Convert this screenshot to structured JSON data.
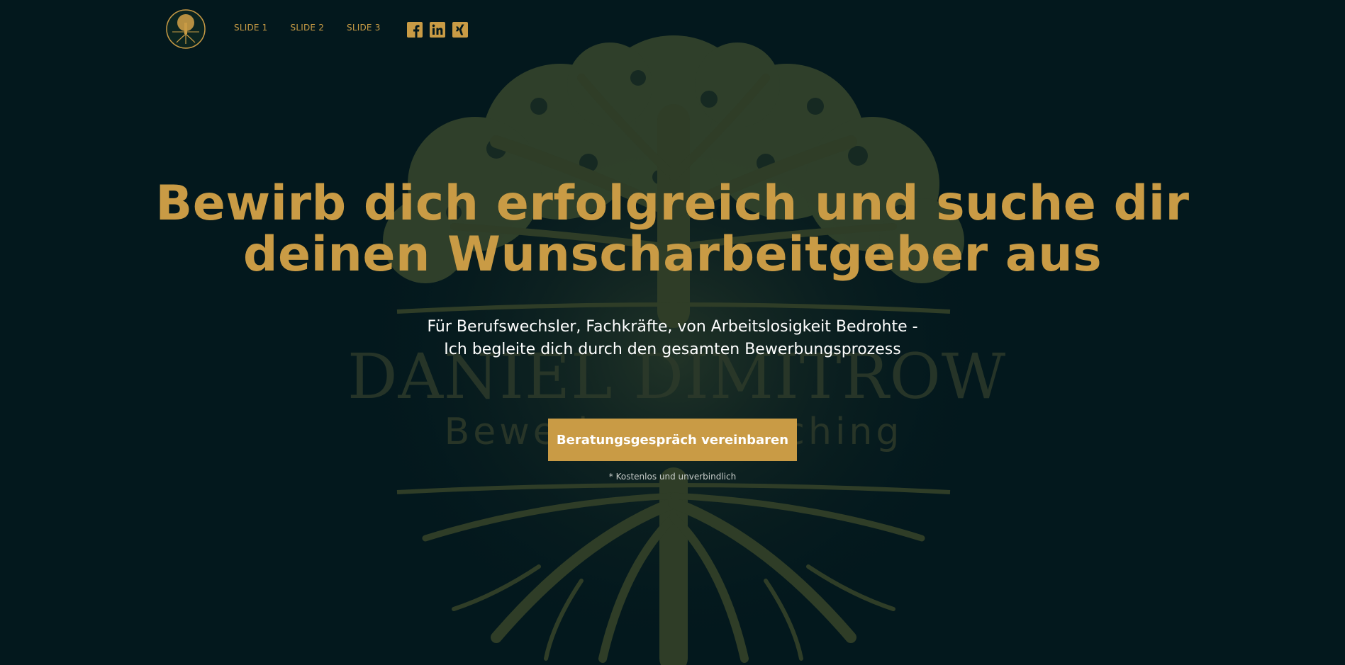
{
  "colors": {
    "background": "#03181d",
    "accent": "#c99b45",
    "text": "#ffffff",
    "watermark": "#2d3a2a"
  },
  "header": {
    "logo": {
      "icon": "tree-logo-icon",
      "text_line1": "DANIEL DIMITROW",
      "text_line2": "Bewerbungscoaching"
    },
    "nav": [
      {
        "label": "SLIDE 1"
      },
      {
        "label": "SLIDE 2"
      },
      {
        "label": "SLIDE 3"
      }
    ],
    "social": [
      {
        "icon": "facebook-icon"
      },
      {
        "icon": "linkedin-icon"
      },
      {
        "icon": "xing-icon"
      }
    ]
  },
  "hero": {
    "headline_line1": "Bewirb dich erfolgreich und suche dir",
    "headline_line2": "deinen Wunscharbeitgeber aus",
    "subheadline_line1": "Für Berufswechsler, Fachkräfte, von Arbeitslosigkeit Bedrohte -",
    "subheadline_line2": "Ich begleite dich durch den gesamten Bewerbungsprozess",
    "cta_label": "Beratungsgespräch vereinbaren",
    "note": "* Kostenlos und unverbindlich"
  },
  "background": {
    "icon": "tree-of-life-icon",
    "watermark_name": "DANIEL DIMITROW",
    "watermark_sub": "Bewerbungscoaching"
  }
}
